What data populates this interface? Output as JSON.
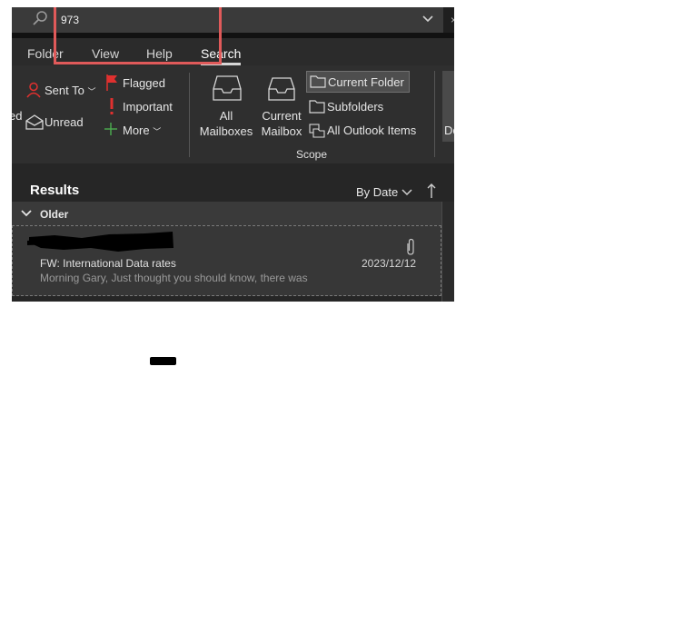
{
  "search": {
    "query": "973"
  },
  "tabs": [
    {
      "label": "Folder"
    },
    {
      "label": "View"
    },
    {
      "label": "Help"
    },
    {
      "label": "Search",
      "active": true
    }
  ],
  "ribbon": {
    "cut_label": "ed",
    "sent_to": "Sent To",
    "unread": "Unread",
    "flagged": "Flagged",
    "important": "Important",
    "more": "More",
    "all_mailboxes": [
      "All",
      "Mailboxes"
    ],
    "current_mailbox": [
      "Current",
      "Mailbox"
    ],
    "current_folder": "Current Folder",
    "subfolders": "Subfolders",
    "all_outlook_items": "All Outlook Items",
    "scope_label": "Scope",
    "right_cut_label": "De"
  },
  "results": {
    "title": "Results",
    "sort": "By Date",
    "group": "Older",
    "items": [
      {
        "subject": "FW: International Data rates",
        "preview": "Morning Gary,  Just thought you should know, there was",
        "date": "2023/12/12"
      }
    ]
  },
  "colors": {
    "accent_red_box": "#e05a5a",
    "flag_red": "#e0302f",
    "background": "#262626"
  },
  "icons": [
    "search-icon",
    "chevron-down-icon",
    "person-icon",
    "envelope-open-icon",
    "flag-icon",
    "exclamation-icon",
    "plus-icon",
    "inbox-tray-icon",
    "folder-icon",
    "calendar-folder-icon",
    "paperclip-icon",
    "arrow-up-icon"
  ]
}
